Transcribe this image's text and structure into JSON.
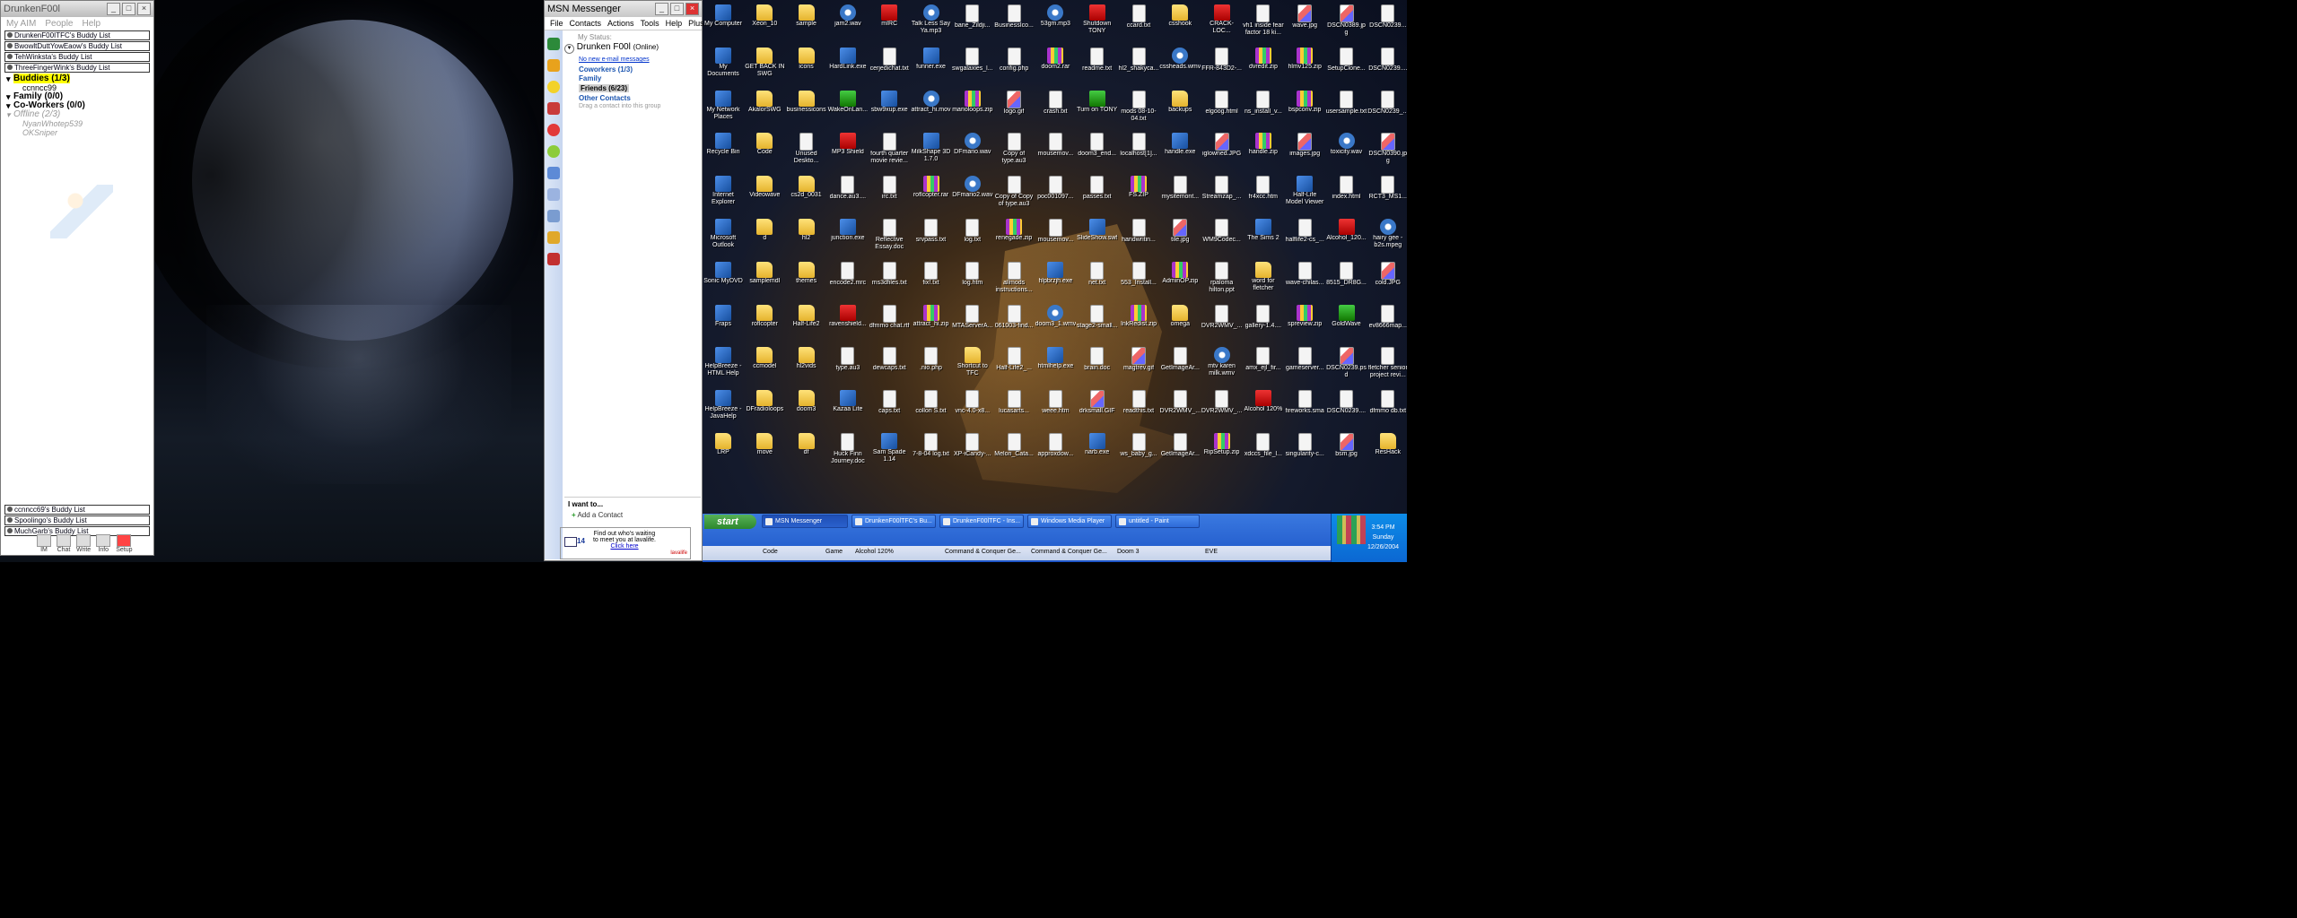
{
  "aim": {
    "title": "DrunkenF00l",
    "menu": [
      "My AIM",
      "People",
      "Help"
    ],
    "buddy_lists_top": [
      "DrunkenF00ITFC's Buddy List",
      "BwowltDuttYowEaow's Buddy List",
      "TehWinksta's Buddy List",
      "ThreeFingerWink's Buddy List"
    ],
    "groups": [
      {
        "label": "Buddies (1/3)",
        "members": [
          "ccnncc99"
        ]
      },
      {
        "label": "Family (0/0)",
        "members": []
      },
      {
        "label": "Co-Workers (0/0)",
        "members": []
      },
      {
        "label": "Offline (2/3)",
        "members": [
          "NyanWhotep539",
          "OKSniper"
        ]
      }
    ],
    "buddy_lists_bottom": [
      "ccnncc69's Buddy List",
      "Spoolingo's Buddy List",
      "MuchGarb's Buddy List"
    ],
    "toolbar": [
      "IM",
      "Chat",
      "Write",
      "Info",
      "Setup"
    ]
  },
  "msn": {
    "title": "MSN Messenger",
    "menu": [
      "File",
      "Contacts",
      "Actions",
      "Tools",
      "Help",
      "Plus!"
    ],
    "status_label": "My Status:",
    "name": "Drunken F00l",
    "status": "(Online)",
    "email_link": "No new e-mail messages",
    "groups": [
      "Coworkers (1/3)",
      "Family",
      "Friends (6/23)",
      "Other Contacts"
    ],
    "drag_hint": "Drag a contact into this group",
    "want_to": "I want to...",
    "add_contact": "Add a Contact",
    "ad": {
      "count": "14",
      "line1": "Find out who's waiting",
      "line2": "to meet you at lavalife.",
      "link": "Click here",
      "brand": "lavalife"
    }
  },
  "desktop": {
    "icons": [
      [
        "My Computer",
        "My Documents",
        "My Network Places",
        "Recycle Bin",
        "Internet Explorer",
        "Microsoft Outlook",
        "Sonic MyDVD",
        "Fraps",
        "HelpBreeze - HTML Help",
        "HelpBreeze - JavaHelp",
        "LRP"
      ],
      [
        "Xeon_10",
        "GET BACK IN SWG",
        "AkalorSWG",
        "Code",
        "Videowave",
        "d",
        "samplemdl",
        "roflcopter",
        "ccmodel",
        "DFradioloops",
        "move"
      ],
      [
        "sample",
        "icons",
        "businessicons",
        "Unused Deskto...",
        "cs2d_0031",
        "hl2",
        "themes",
        "Half-Life2",
        "hl2vids",
        "doom3",
        "df"
      ],
      [
        "jam2.wav",
        "HardLink.exe",
        "WakeOnLan...",
        "MP3 Shield",
        "dance.au3....",
        "junction.exe",
        "encode2.mrc",
        "ravenshield...",
        "type.au3",
        "Kazaa Lite",
        "Huck Finn Journey.doc"
      ],
      [
        "mIRC",
        "cerjedichat.txt",
        "sbw9xup.exe",
        "fourth quarter movie revie...",
        "irc.txt",
        "Reflective Essay.doc",
        "ms3dfiles.txt",
        "dfmmo chat.rtf",
        "dewcaps.txt",
        "caps.txt",
        "Sam Spade 1.14"
      ],
      [
        "Talk Less Say Ya.mp3",
        "funner.exe",
        "attract_hi.mov",
        "MilkShape 3D 1.7.0",
        "roflcopter.rar",
        "srvpass.txt",
        "fix!.txt",
        "attract_hi.zip",
        ".nio.php",
        "collon S.txt",
        "7-8-04 log.txt"
      ],
      [
        "bane_Zildji...",
        "swgalaxies_l...",
        "marioloops.zip",
        "DFmario.wav",
        "DFmario2.wav",
        "log.txt",
        "log.htm",
        "MTAServerA...",
        "Shortcut to TFC",
        "vnc-4.0-x8...",
        "XP-iCandy-..."
      ],
      [
        "BusinessIco...",
        "config.php",
        "logo.gif",
        "Copy of type.au3",
        "Copy of Copy of type.au3",
        "renegade.zip",
        "allmods instructions...",
        "061003-find...",
        "Half-Life2_...",
        "lucasarts...",
        "Melon_Cata..."
      ],
      [
        "53gm.mp3",
        "doom2.rar",
        "crash.txt",
        "mousemov...",
        "poc001097...",
        "mousemov...",
        "hlpbrzjh.exe",
        "doom3_1.wmv",
        "htmlhelp.exe",
        "weee.htm",
        "approxdow..."
      ],
      [
        "Shutdown TONY",
        "readme.txt",
        "Turn on TONY",
        "doom3_end...",
        "passes.txt",
        "SlideShow.swf",
        "net.txt",
        "stage2-small...",
        "brain.doc",
        "drksmall.GIF",
        "narb.exe"
      ],
      [
        "ccard.txt",
        "hl2_shakyca...",
        "mods 08-10-04.txt",
        "localhost[1]...",
        "FS.ZIP",
        "handwritin...",
        "553_Install...",
        "InkRedist.zip",
        "magtrev.gif",
        "readthis.txt",
        "ws_baby_g..."
      ],
      [
        "csshook",
        "cssheads.wmv",
        "backups",
        "handle.exe",
        "mysitemont...",
        "tile.jpg",
        "AdminOP.zip",
        "omega",
        "GetImageAr...",
        "DVR2WMV_...",
        "GetImageAr..."
      ],
      [
        "CRACK-LOC...",
        "FFR-843D2-...",
        "elgoog.html",
        "iglowned.JPG",
        "Streamzap_...",
        "WM9Codec...",
        "rpaloma hilton.ppt",
        "DVR2WMV_...",
        "mtv karen milk.wmv",
        "DVR2WMV_...",
        "RipSetup.zip"
      ],
      [
        "vh1 inside fear factor 18 ki...",
        "dvredit.zip",
        "ns_install_v...",
        "handle.zip",
        "fr4xcc.htm",
        "The Sims 2",
        "word for fletcher",
        "gallery-1.4....",
        "amx_ejl_fir...",
        "Alcohol 120%",
        "xdccs_file_l..."
      ],
      [
        "wave.jpg",
        "hlmv125.zip",
        "bspconv.zip",
        "images.jpg",
        "Half-Life Model Viewer",
        "halflife2-cs_...",
        "wave-chilas...",
        "spreview.zip",
        "gameserver...",
        "fireworks.sma",
        "singularity-c..."
      ],
      [
        "DSCN0389.jpg",
        "SetupClone...",
        "usersample.txt",
        "toxicity.wav",
        "index.html",
        "Alcohol_120...",
        "8515_DR8G...",
        "GoldWave",
        "DSCN0239.psd",
        "DSCN0239....",
        "bsm.jpg"
      ],
      [
        "DSCN0239...",
        "DSCN0239....",
        "DSCN0239_...",
        "DSCN0390.jpg",
        "RCT3_MS1...",
        "hairy gee - b2s.mpeg",
        "cold.JPG",
        "ev8666map...",
        "fletcher senior project revi...",
        "dfmmo db.txt",
        "ResHack"
      ]
    ]
  },
  "taskbar": {
    "start": "start",
    "tasks": [
      "MSN Messenger",
      "DrunkenF00lTFC's Bu...",
      "DrunkenF00lTFC - Ins...",
      "Windows Media Player",
      "untitled - Paint"
    ],
    "clock": {
      "time": "3:54 PM",
      "day": "Sunday",
      "date": "12/26/2004"
    },
    "quick_launch": [
      "Code",
      "Game",
      "Alcohol 120%",
      "Command & Conquer Ge...",
      "Command & Conquer Ge...",
      "Doom 3",
      "EVE"
    ]
  }
}
